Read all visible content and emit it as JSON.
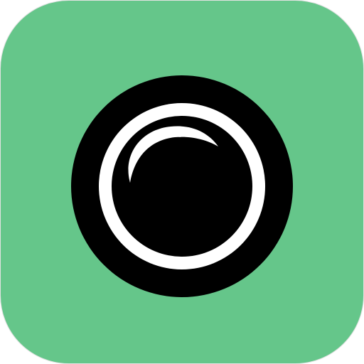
{
  "app_icon": {
    "icon": "camera-lens-icon",
    "colors": {
      "background": "#65c68a",
      "lens_body": "#000000",
      "lens_ring": "#ffffff",
      "highlight": "#ffffff"
    }
  }
}
